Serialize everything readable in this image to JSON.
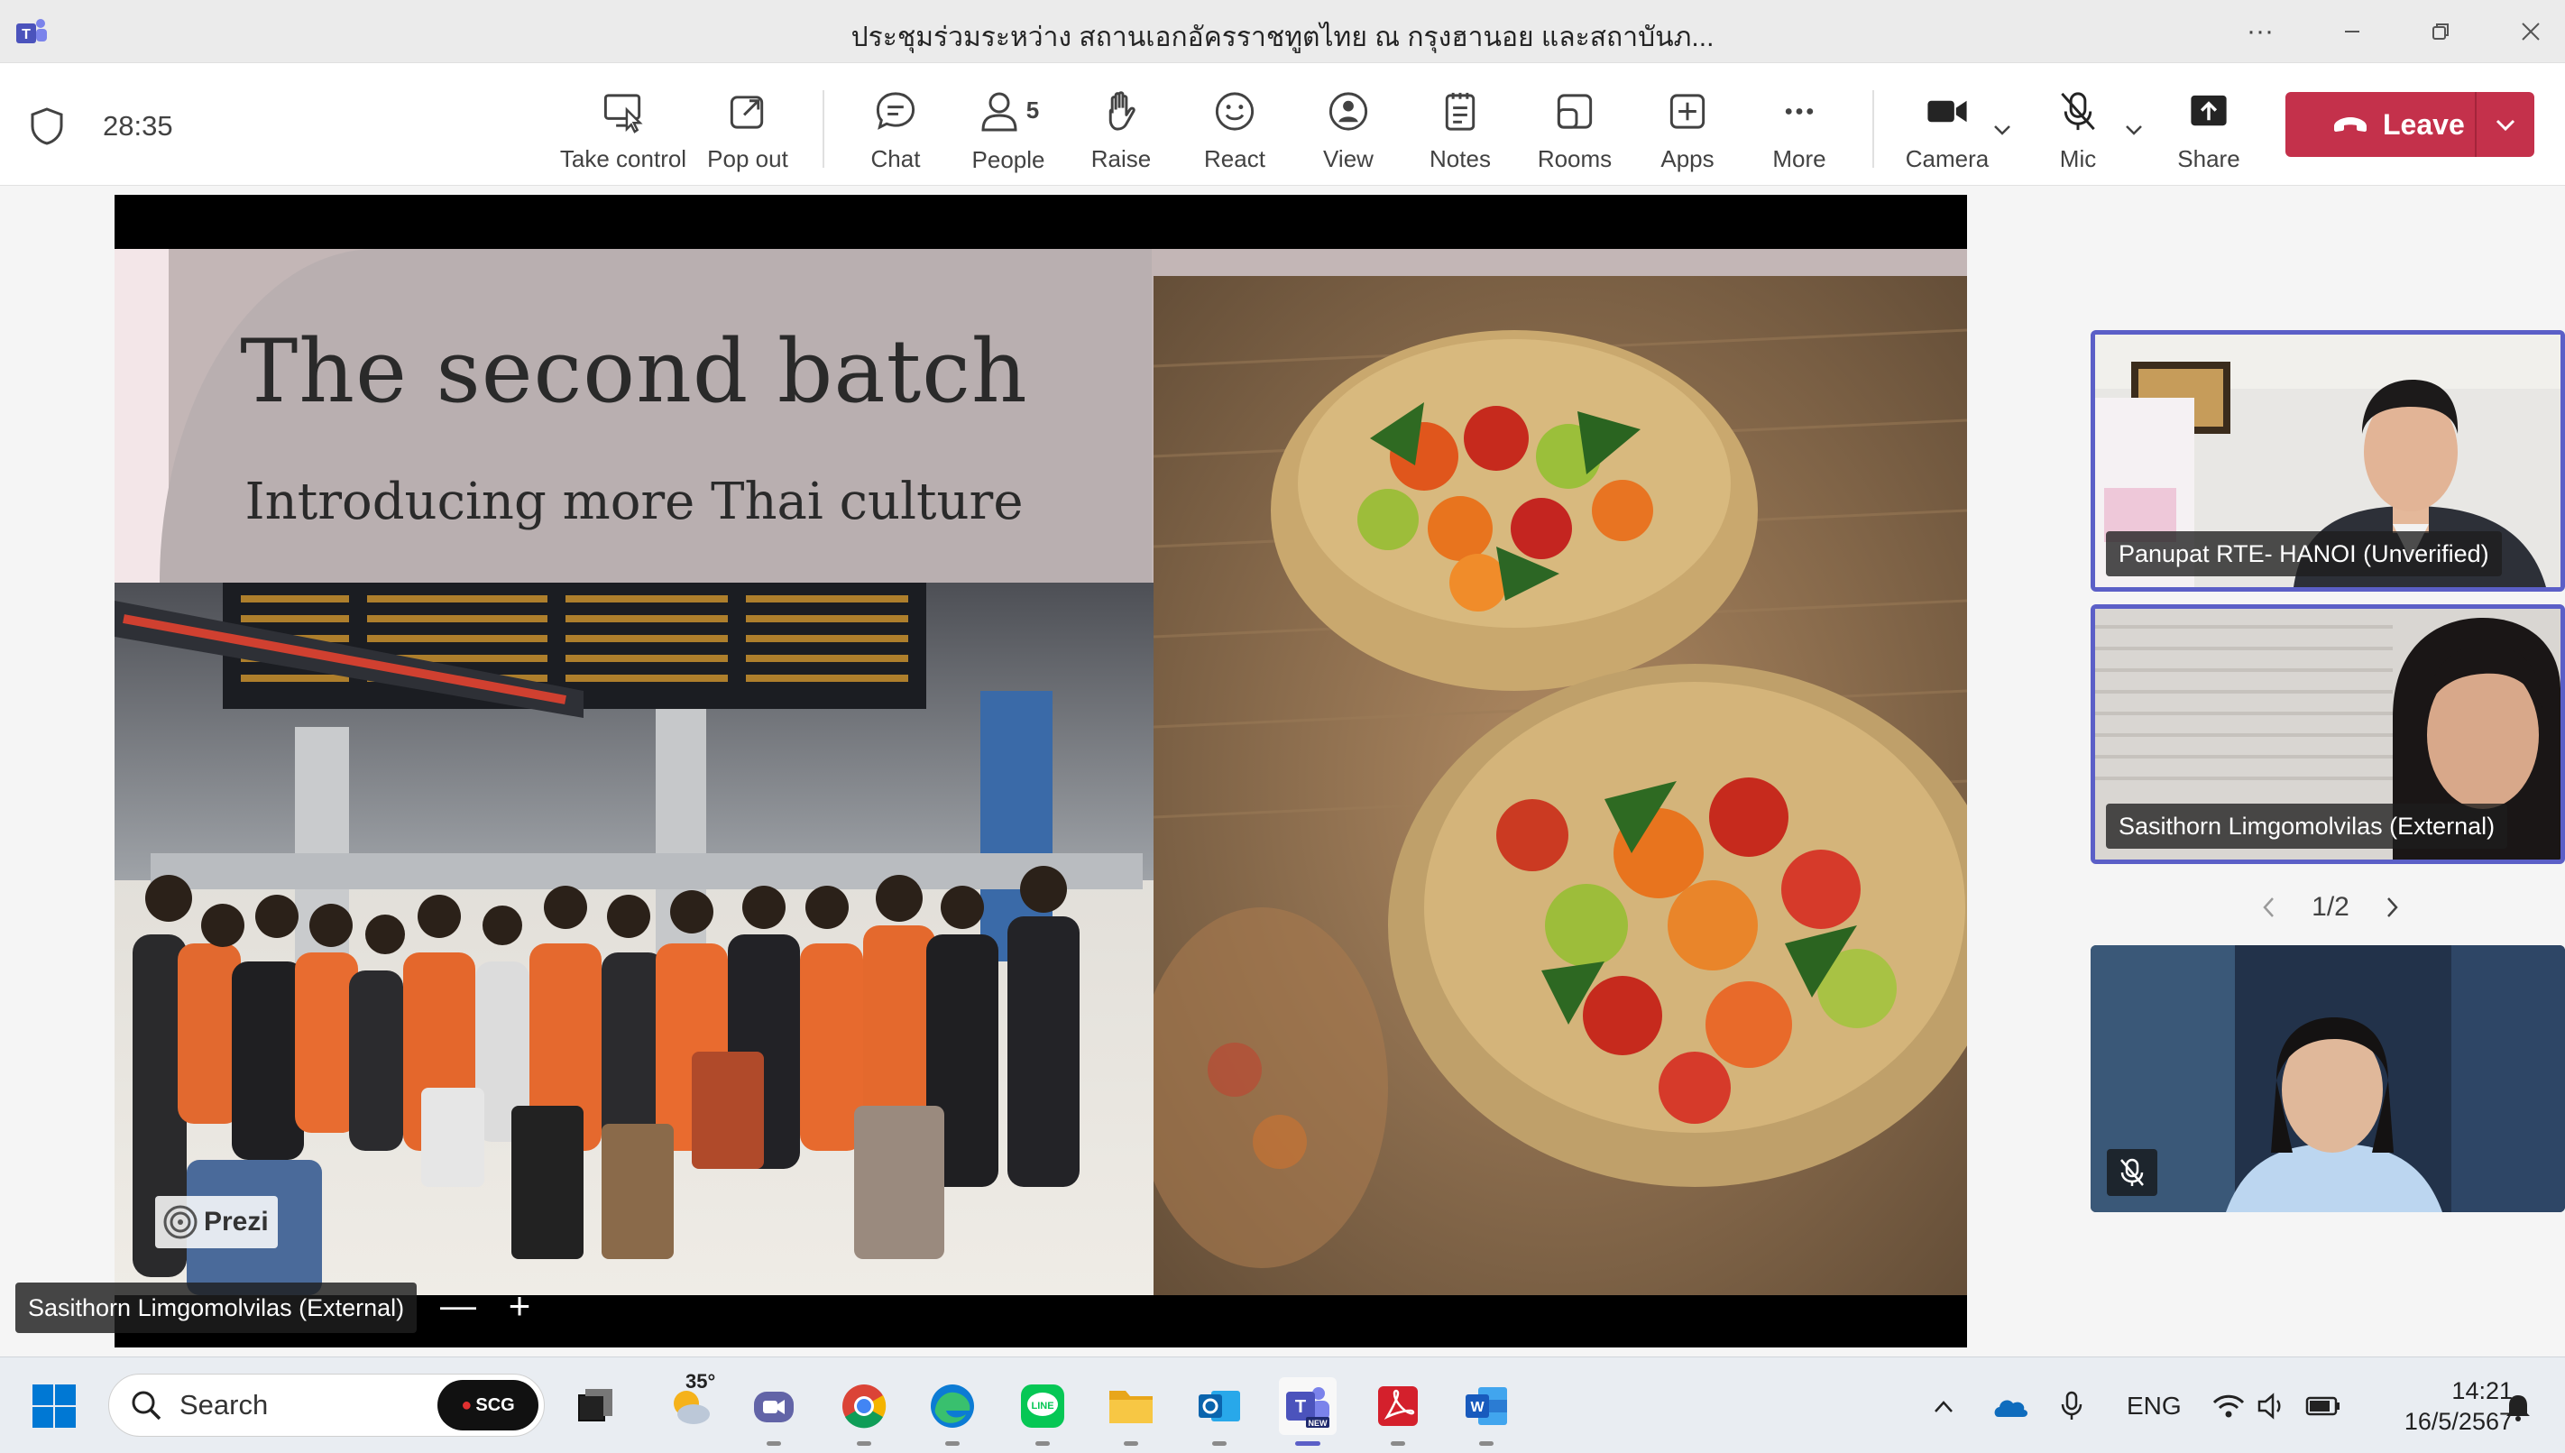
{
  "window": {
    "title": "ประชุมร่วมระหว่าง สถานเอกอัครราชทูตไทย ณ กรุงฮานอย และสถาบันภ...",
    "more_label": "···"
  },
  "toolbar": {
    "timer": "28:35",
    "take_control": "Take control",
    "pop_out": "Pop out",
    "chat": "Chat",
    "people": "People",
    "people_count": "5",
    "raise": "Raise",
    "react": "React",
    "view": "View",
    "notes": "Notes",
    "rooms": "Rooms",
    "apps": "Apps",
    "more": "More",
    "camera": "Camera",
    "mic": "Mic",
    "share": "Share",
    "leave": "Leave"
  },
  "slide": {
    "title": "The second batch",
    "subtitle": "Introducing more Thai culture",
    "badge": "Prezi"
  },
  "presenter": {
    "name": "Sasithorn Limgomolvilas (External)",
    "zoom_out": "—",
    "zoom_in": "+"
  },
  "participants": [
    {
      "name": "Panupat RTE- HANOI (Unverified)"
    },
    {
      "name": "Sasithorn Limgomolvilas (External)"
    }
  ],
  "pager": {
    "label": "1/2"
  },
  "taskbar": {
    "search_placeholder": "Search",
    "scg_label": "SCG",
    "weather_temp": "35°",
    "lang": "ENG",
    "time": "14:21",
    "date": "16/5/2567"
  },
  "colors": {
    "leave_red": "#c4314b",
    "teams_accent": "#5b5fc7",
    "slide_bg": "#c3b6b6"
  }
}
